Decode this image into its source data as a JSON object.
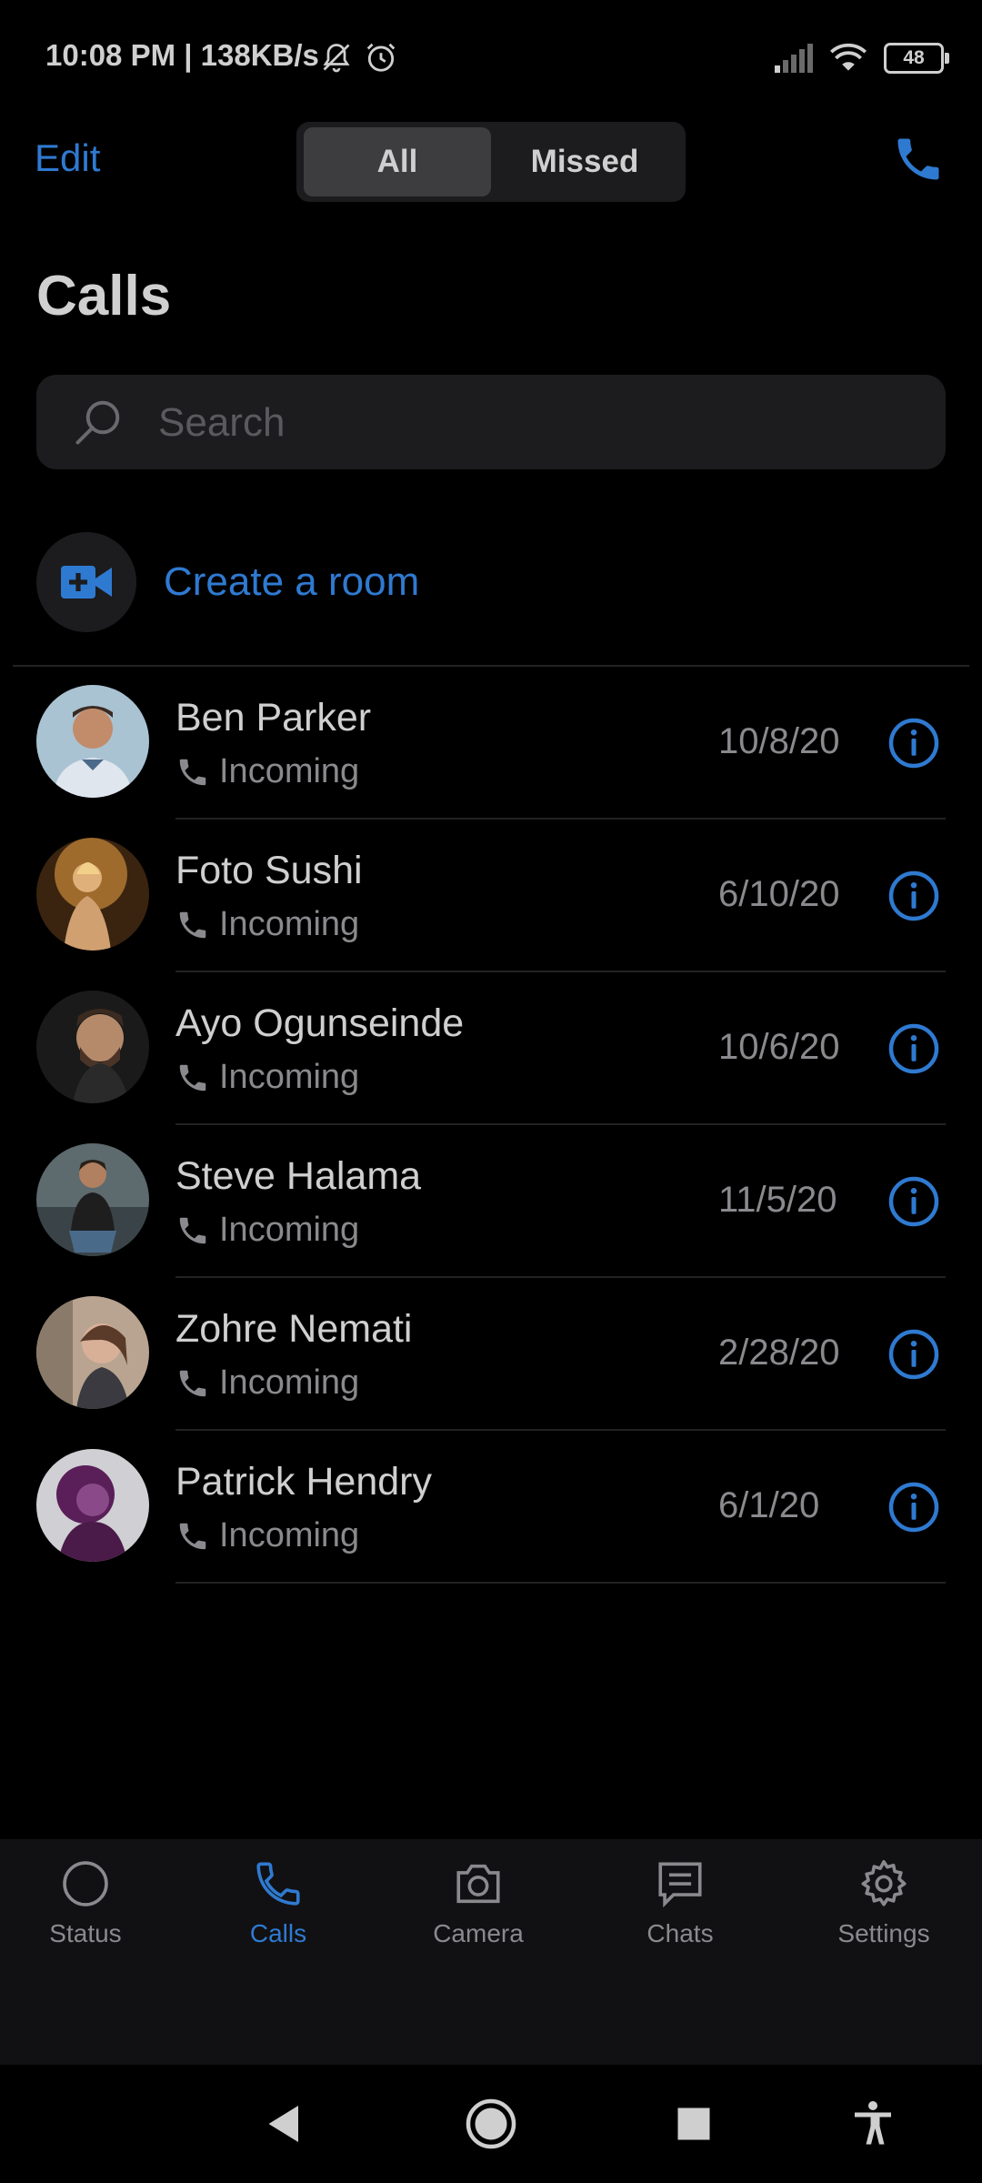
{
  "status_bar": {
    "time": "10:08 PM | 138KB/s",
    "battery": "48"
  },
  "header": {
    "edit_label": "Edit",
    "segments": {
      "all": "All",
      "missed": "Missed"
    },
    "active_segment": "All"
  },
  "page_title": "Calls",
  "search": {
    "placeholder": "Search"
  },
  "create_room": {
    "label": "Create a room"
  },
  "calls": [
    {
      "name": "Ben Parker",
      "type": "Incoming",
      "date": "10/8/20"
    },
    {
      "name": "Foto Sushi",
      "type": "Incoming",
      "date": "6/10/20"
    },
    {
      "name": "Ayo Ogunseinde",
      "type": "Incoming",
      "date": "10/6/20"
    },
    {
      "name": "Steve Halama",
      "type": "Incoming",
      "date": "11/5/20"
    },
    {
      "name": "Zohre Nemati",
      "type": "Incoming",
      "date": "2/28/20"
    },
    {
      "name": "Patrick Hendry",
      "type": "Incoming",
      "date": "6/1/20"
    }
  ],
  "tabs": [
    {
      "label": "Status",
      "icon": "status-circle-icon"
    },
    {
      "label": "Calls",
      "icon": "phone-icon",
      "active": true
    },
    {
      "label": "Camera",
      "icon": "camera-icon"
    },
    {
      "label": "Chats",
      "icon": "chat-bubble-icon"
    },
    {
      "label": "Settings",
      "icon": "gear-icon"
    }
  ],
  "colors": {
    "accent": "#2f7ad1",
    "background": "#000000",
    "surface": "#1c1c1e",
    "secondary_text": "#8a8a8e"
  }
}
